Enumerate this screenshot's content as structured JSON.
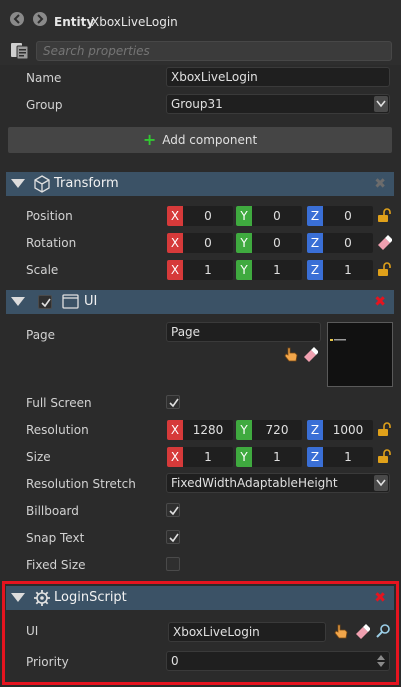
{
  "header": {
    "kind": "Entity",
    "name": "XboxLiveLogin"
  },
  "search": {
    "placeholder": "Search properties"
  },
  "entity": {
    "name_label": "Name",
    "name_value": "XboxLiveLogin",
    "group_label": "Group",
    "group_value": "Group31",
    "add_component_label": "Add component"
  },
  "transform": {
    "title": "Transform",
    "rows": [
      {
        "label": "Position",
        "x": "0",
        "y": "0",
        "z": "0"
      },
      {
        "label": "Rotation",
        "x": "0",
        "y": "0",
        "z": "0"
      },
      {
        "label": "Scale",
        "x": "1",
        "y": "1",
        "z": "1"
      }
    ]
  },
  "ui": {
    "title": "UI",
    "page_label": "Page",
    "page_value": "Page",
    "fullscreen_label": "Full Screen",
    "resolution_label": "Resolution",
    "resolution": {
      "x": "1280",
      "y": "720",
      "z": "1000"
    },
    "size_label": "Size",
    "size": {
      "x": "1",
      "y": "1",
      "z": "1"
    },
    "stretch_label": "Resolution Stretch",
    "stretch_value": "FixedWidthAdaptableHeight",
    "billboard_label": "Billboard",
    "snaptext_label": "Snap Text",
    "fixedsize_label": "Fixed Size"
  },
  "axes": {
    "x": "X",
    "y": "Y",
    "z": "Z"
  },
  "loginscript": {
    "title": "LoginScript",
    "ui_label": "UI",
    "ui_value": "XboxLiveLogin",
    "priority_label": "Priority",
    "priority_value": "0"
  },
  "colors": {
    "section_header": "#3b5266",
    "highlight": "#e5141f",
    "axis_x": "#d63a3a",
    "axis_y": "#3faa3f",
    "axis_z": "#3a6fd6",
    "add_plus": "#32c832"
  }
}
